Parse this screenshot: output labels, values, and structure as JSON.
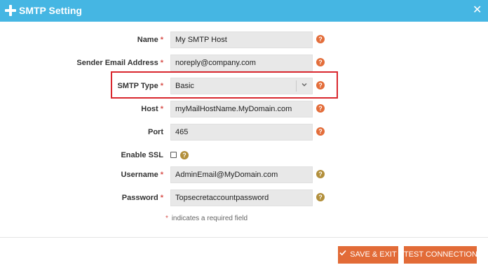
{
  "dialog": {
    "title": "SMTP Setting",
    "close_glyph": "✕",
    "icons": {
      "title": "plus-icon",
      "close": "close-icon",
      "help": "question-mark-icon",
      "dropdown": "chevron-down-icon",
      "save": "checkmark-icon"
    }
  },
  "form": {
    "required_marker": "*",
    "help_glyph": "?",
    "name": {
      "label": "Name",
      "value": "My SMTP Host",
      "required": true
    },
    "sender_email": {
      "label": "Sender Email Address",
      "value": "noreply@company.com",
      "required": true
    },
    "smtp_type": {
      "label": "SMTP Type",
      "value": "Basic",
      "required": true
    },
    "host": {
      "label": "Host",
      "value": "myMailHostName.MyDomain.com",
      "required": true
    },
    "port": {
      "label": "Port",
      "value": "465",
      "required": false
    },
    "enable_ssl": {
      "label": "Enable SSL",
      "checked": false
    },
    "username": {
      "label": "Username",
      "value": "AdminEmail@MyDomain.com",
      "required": true
    },
    "password": {
      "label": "Password",
      "value": "Topsecretaccountpassword",
      "required": true
    },
    "footnote": "indicates a required field"
  },
  "footer": {
    "save_label": "SAVE & EXIT",
    "test_label": "TEST CONNECTION"
  },
  "colors": {
    "titlebar": "#45b6e3",
    "accent": "#e26b37",
    "required": "#d9534f",
    "highlight_border": "#d9272e",
    "field_bg": "#e8e8e8"
  }
}
